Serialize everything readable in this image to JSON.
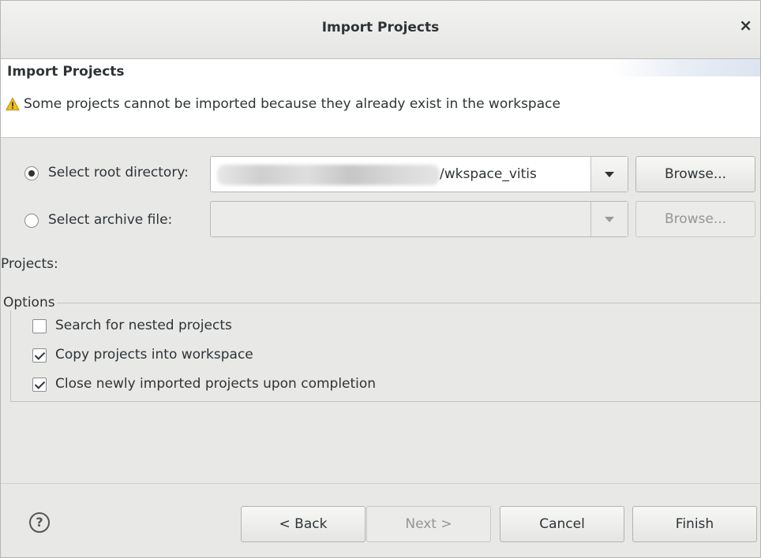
{
  "window": {
    "title": "Import Projects",
    "close_icon": "×"
  },
  "header": {
    "heading": "Import Projects",
    "warning_icon": "warning-triangle",
    "message": "Some projects cannot be imported because they already exist in the workspace"
  },
  "source": {
    "root_directory": {
      "label": "Select root directory:",
      "selected": true,
      "value": "/wkspace_vitis",
      "browse_label": "Browse..."
    },
    "archive_file": {
      "label": "Select archive file:",
      "selected": false,
      "value": "",
      "browse_label": "Browse..."
    }
  },
  "projects_label": "Projects:",
  "options": {
    "legend": "Options",
    "items": [
      {
        "label": "Search for nested projects",
        "checked": false
      },
      {
        "label": "Copy projects into workspace",
        "checked": true
      },
      {
        "label": "Close newly imported projects upon completion",
        "checked": true
      }
    ]
  },
  "footer": {
    "help_icon": "?",
    "back_label": "< Back",
    "next_label": "Next >",
    "cancel_label": "Cancel",
    "finish_label": "Finish"
  },
  "colors": {
    "accent": "#2e3436",
    "background": "#e8e8e7",
    "header_bg": "#ffffff",
    "warning": "#f5c211"
  }
}
